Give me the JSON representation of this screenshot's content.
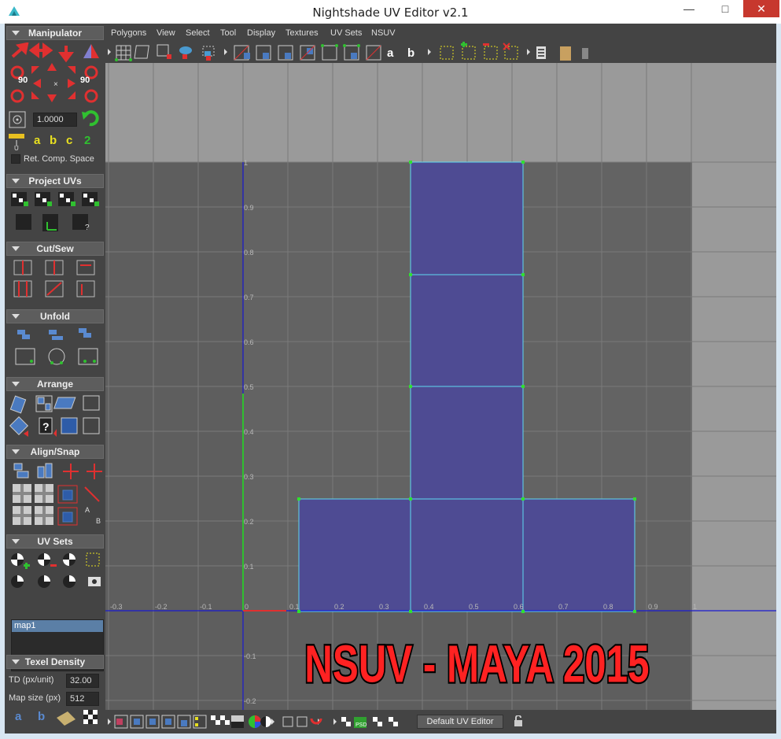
{
  "window": {
    "title": "Nightshade UV Editor v2.1"
  },
  "menus": [
    "Polygons",
    "View",
    "Select",
    "Tool",
    "Display",
    "Textures",
    "UV Sets",
    "NSUV"
  ],
  "toolbar": {
    "letter_a": "a",
    "letter_b": "b"
  },
  "panel": {
    "sections": [
      "Manipulator",
      "Project UVs",
      "Cut/Sew",
      "Unfold",
      "Arrange",
      "Align/Snap",
      "UV Sets",
      "Texel Density"
    ],
    "manipulator": {
      "rot_left": "90",
      "rot_right": "90",
      "value": "1.0000",
      "abc": [
        "a",
        "b",
        "c",
        "2"
      ],
      "ret_comp_space": "Ret. Comp. Space"
    },
    "uvsets": {
      "items": [
        "map1"
      ]
    },
    "texel": {
      "td_label": "TD (px/unit)",
      "td_value": "32.00",
      "map_label": "Map size (px)",
      "map_value": "512",
      "letters": [
        "a",
        "b"
      ]
    }
  },
  "grid": {
    "x_ticks": [
      "-0.3",
      "-0.2",
      "-0.1",
      "0",
      "0.1",
      "0.2",
      "0.3",
      "0.4",
      "0.5",
      "0.6",
      "0.7",
      "0.8",
      "0.9",
      "1"
    ],
    "y_ticks": [
      "1",
      "0.9",
      "0.8",
      "0.7",
      "0.6",
      "0.5",
      "0.4",
      "0.3",
      "0.2",
      "0.1",
      "-0.1",
      "-0.2"
    ]
  },
  "overlay": {
    "caption": "NSUV - MAYA 2015"
  },
  "bottom": {
    "editor_button": "Default UV Editor"
  },
  "colors": {
    "uv_fill": "#4e4b93",
    "uv_edge": "#5fd8f0",
    "vertex": "#30e030",
    "u_axis": "#1a1ad0",
    "v_axis": "#30c030",
    "caption_red": "#ff2222"
  }
}
